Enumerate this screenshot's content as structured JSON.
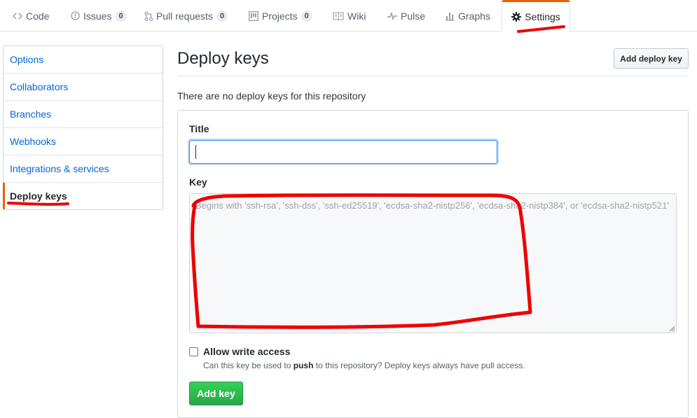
{
  "reponav": {
    "tabs": [
      {
        "label": "Code",
        "icon": "code-icon"
      },
      {
        "label": "Issues",
        "icon": "issue-icon",
        "count": "0"
      },
      {
        "label": "Pull requests",
        "icon": "pull-request-icon",
        "count": "0"
      },
      {
        "label": "Projects",
        "icon": "project-icon",
        "count": "0"
      },
      {
        "label": "Wiki",
        "icon": "book-icon"
      },
      {
        "label": "Pulse",
        "icon": "pulse-icon"
      },
      {
        "label": "Graphs",
        "icon": "graph-icon"
      },
      {
        "label": "Settings",
        "icon": "gear-icon",
        "selected": true
      }
    ]
  },
  "sidebar": {
    "items": [
      {
        "label": "Options"
      },
      {
        "label": "Collaborators"
      },
      {
        "label": "Branches"
      },
      {
        "label": "Webhooks"
      },
      {
        "label": "Integrations & services"
      },
      {
        "label": "Deploy keys",
        "selected": true
      }
    ]
  },
  "main": {
    "title": "Deploy keys",
    "add_deploy_key_label": "Add deploy key",
    "empty_message": "There are no deploy keys for this repository",
    "form": {
      "title_label": "Title",
      "title_value": "",
      "key_label": "Key",
      "key_placeholder": "Begins with 'ssh-rsa', 'ssh-dss', 'ssh-ed25519', 'ecdsa-sha2-nistp256', 'ecdsa-sha2-nistp384', or 'ecdsa-sha2-nistp521'",
      "allow_write_label": "Allow write access",
      "allow_write_checked": false,
      "note_prefix": "Can this key be used to ",
      "note_bold": "push",
      "note_suffix": " to this repository? Deploy keys always have pull access.",
      "submit_label": "Add key"
    }
  },
  "colors": {
    "accent_orange": "#e36209",
    "link_blue": "#0366d6",
    "focus_blue": "#2188ff",
    "button_green": "#28a745",
    "annotation_red": "#ee0000"
  }
}
